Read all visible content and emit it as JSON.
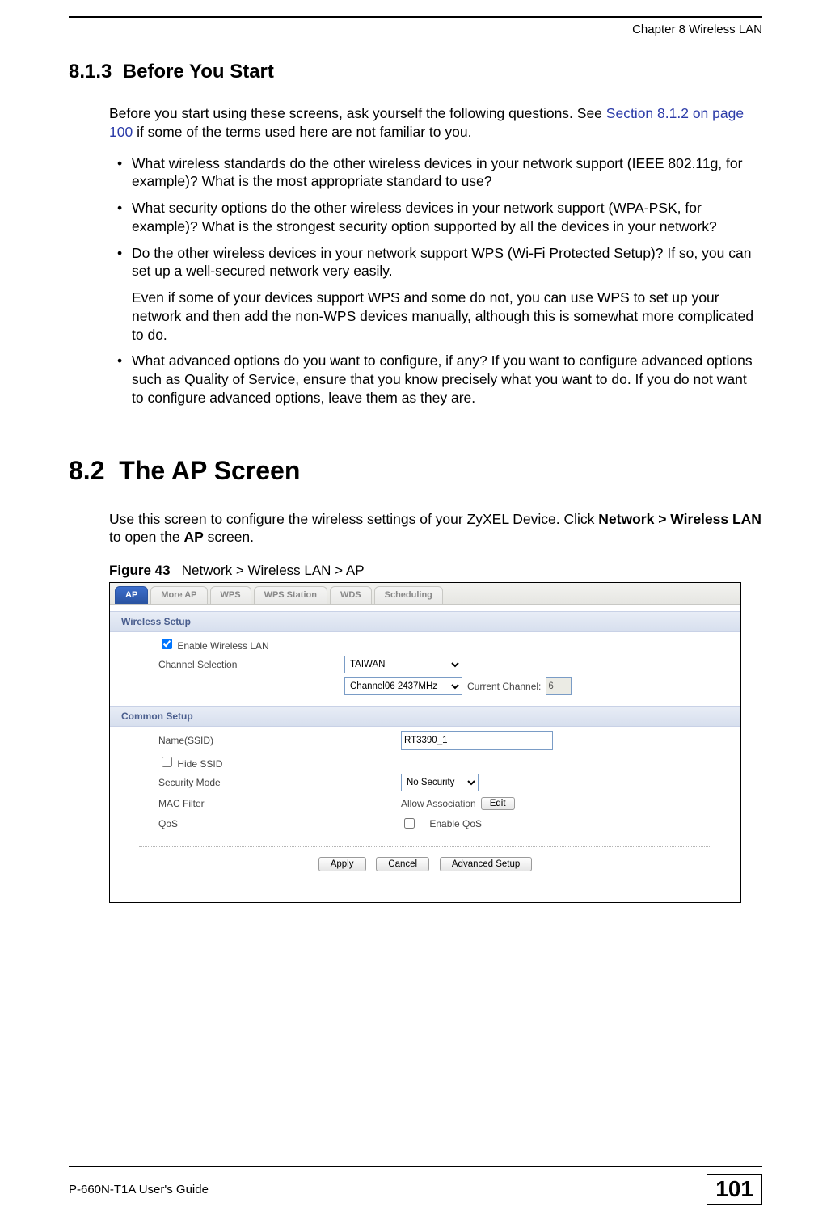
{
  "header": {
    "chapter": "Chapter 8 Wireless LAN"
  },
  "sec813": {
    "num": "8.1.3",
    "title": "Before You Start",
    "intro_a": "Before you start using these screens, ask yourself the following questions. See ",
    "xref": "Section 8.1.2 on page 100",
    "intro_b": " if some of the terms used here are not familiar to you.",
    "b1": "What wireless standards do the other wireless devices in your network support (IEEE 802.11g, for example)? What is the most appropriate standard to use?",
    "b2": "What security options do the other wireless devices in your network support (WPA-PSK, for example)? What is the strongest security option supported by all the devices in your network?",
    "b3": "Do the other wireless devices in your network support WPS (Wi-Fi Protected Setup)? If so, you can set up a well-secured network very easily.",
    "b3p": "Even if some of your devices support WPS and some do not, you can use WPS to set up your network and then add the non-WPS devices manually, although this is somewhat more complicated to do.",
    "b4": "What advanced options do you want to configure, if any? If you want to configure advanced options such as Quality of Service, ensure that you know precisely what you want to do. If you do not want to configure advanced options, leave them as they are."
  },
  "sec82": {
    "num": "8.2",
    "title": "The AP Screen",
    "p_a": "Use this screen to configure the wireless settings of your ZyXEL Device. Click ",
    "p_b": "Network > Wireless LAN",
    "p_c": " to open the ",
    "p_d": "AP",
    "p_e": " screen."
  },
  "figure": {
    "label": "Figure 43",
    "caption": "Network > Wireless LAN > AP",
    "tabs": {
      "ap": "AP",
      "moreap": "More AP",
      "wps": "WPS",
      "wpsstation": "WPS Station",
      "wds": "WDS",
      "scheduling": "Scheduling"
    },
    "sec_wireless": "Wireless Setup",
    "enable_wlan": "Enable Wireless LAN",
    "enable_wlan_checked": true,
    "chansel_label": "Channel Selection",
    "country_value": "TAIWAN",
    "channel_value": "Channel06 2437MHz",
    "curr_channel_label": "Current Channel:",
    "curr_channel_value": "6",
    "sec_common": "Common Setup",
    "ssid_label": "Name(SSID)",
    "ssid_value": "RT3390_1",
    "hide_ssid_label": "Hide SSID",
    "hide_ssid_checked": false,
    "secmode_label": "Security Mode",
    "secmode_value": "No Security",
    "mac_label": "MAC Filter",
    "mac_value": "Allow Association",
    "edit_btn": "Edit",
    "qos_label": "QoS",
    "enable_qos_label": "Enable QoS",
    "enable_qos_checked": false,
    "apply_btn": "Apply",
    "cancel_btn": "Cancel",
    "adv_btn": "Advanced Setup"
  },
  "footer": {
    "guide": "P-660N-T1A User's Guide",
    "page": "101"
  }
}
